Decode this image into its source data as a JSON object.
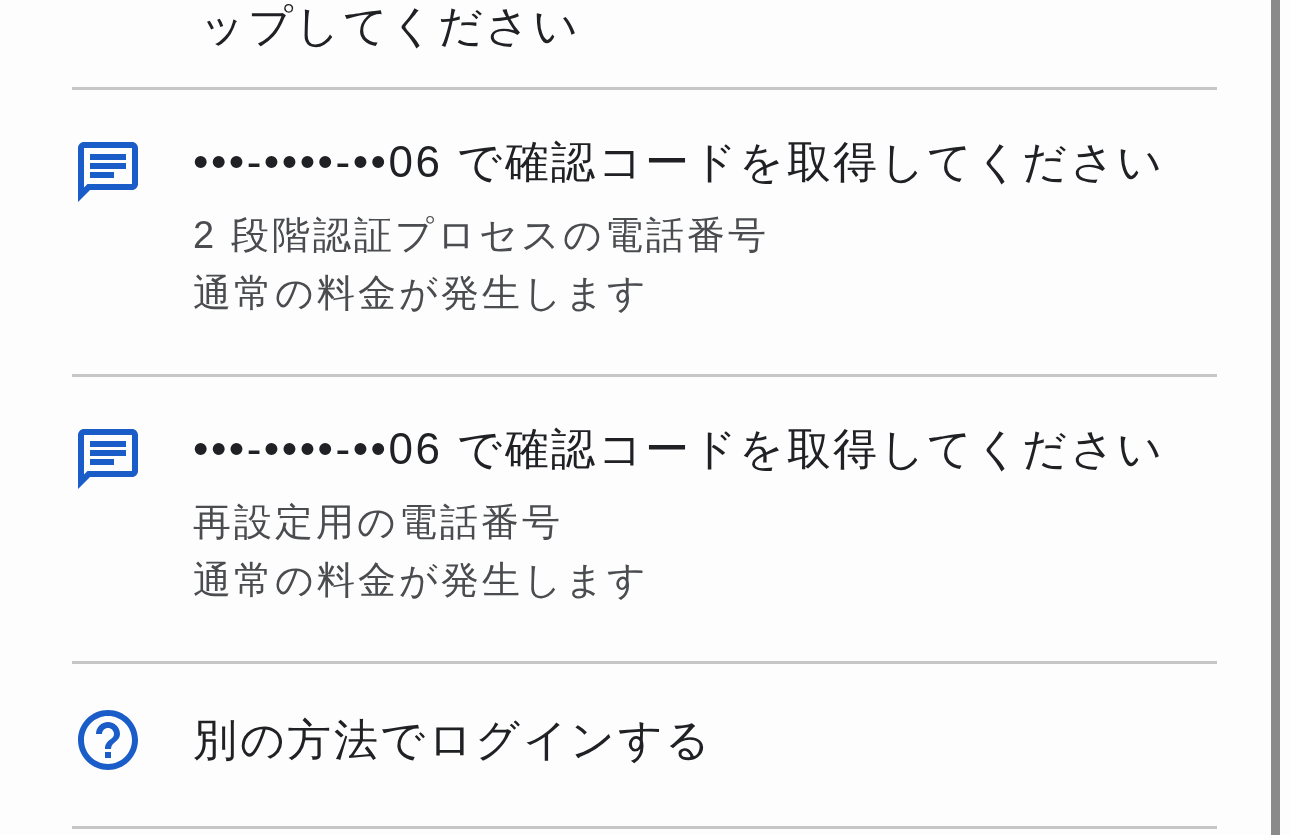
{
  "top_text": "ップしてください",
  "options": [
    {
      "kind": "sms",
      "title": "•••-••••-••06 で確認コードを取得してください",
      "details": [
        "2 段階認証プロセスの電話番号",
        "通常の料金が発生します"
      ]
    },
    {
      "kind": "sms",
      "title": "•••-••••-••06 で確認コードを取得してください",
      "details": [
        "再設定用の電話番号",
        "通常の料金が発生します"
      ]
    },
    {
      "kind": "help",
      "title": "別の方法でログインする"
    }
  ]
}
